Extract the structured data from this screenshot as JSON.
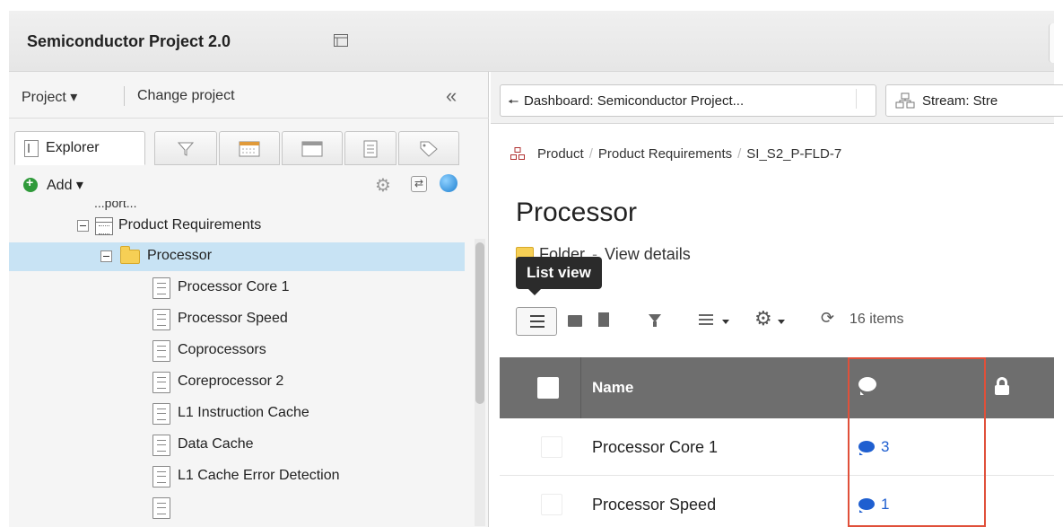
{
  "app": {
    "title": "Semiconductor Project 2.0"
  },
  "left_pane": {
    "project_menu": "Project ▾",
    "change_project": "Change project",
    "tabs": [
      {
        "label": "Explorer",
        "icon": "explorer-icon"
      },
      {
        "icon": "filter-icon"
      },
      {
        "icon": "calendar-icon"
      },
      {
        "icon": "window-icon"
      },
      {
        "icon": "document-icon"
      },
      {
        "icon": "tag-icon"
      }
    ],
    "add_label": "Add ▾",
    "tree": {
      "partial_label": "...port...",
      "product_requirements": "Product Requirements",
      "selected_folder": "Processor",
      "items": [
        "Processor Core 1",
        "Processor Speed",
        "Coprocessors",
        "Coreprocessor 2",
        "L1 Instruction Cache",
        "Data Cache",
        "L1 Cache Error Detection"
      ]
    }
  },
  "right_pane": {
    "tabs": [
      {
        "label": "Dashboard: Semiconductor Project..."
      },
      {
        "label": "Stream: Stre"
      }
    ],
    "breadcrumb": [
      "Product",
      "Product Requirements",
      "SI_S2_P-FLD-7"
    ],
    "page_title": "Processor",
    "subtitle_folder": "Folder",
    "subtitle_view_details": "View details",
    "tooltip": "List view",
    "item_count": "16 items",
    "table": {
      "header_name": "Name",
      "rows": [
        {
          "name": "Processor Core 1",
          "comments": "3"
        },
        {
          "name": "Processor Speed",
          "comments": "1"
        }
      ]
    },
    "colors": {
      "highlight": "#e0503a",
      "comment_blue": "#1f5fd0",
      "header_gray": "#6e6e6e",
      "selection": "#c8e3f4"
    }
  }
}
